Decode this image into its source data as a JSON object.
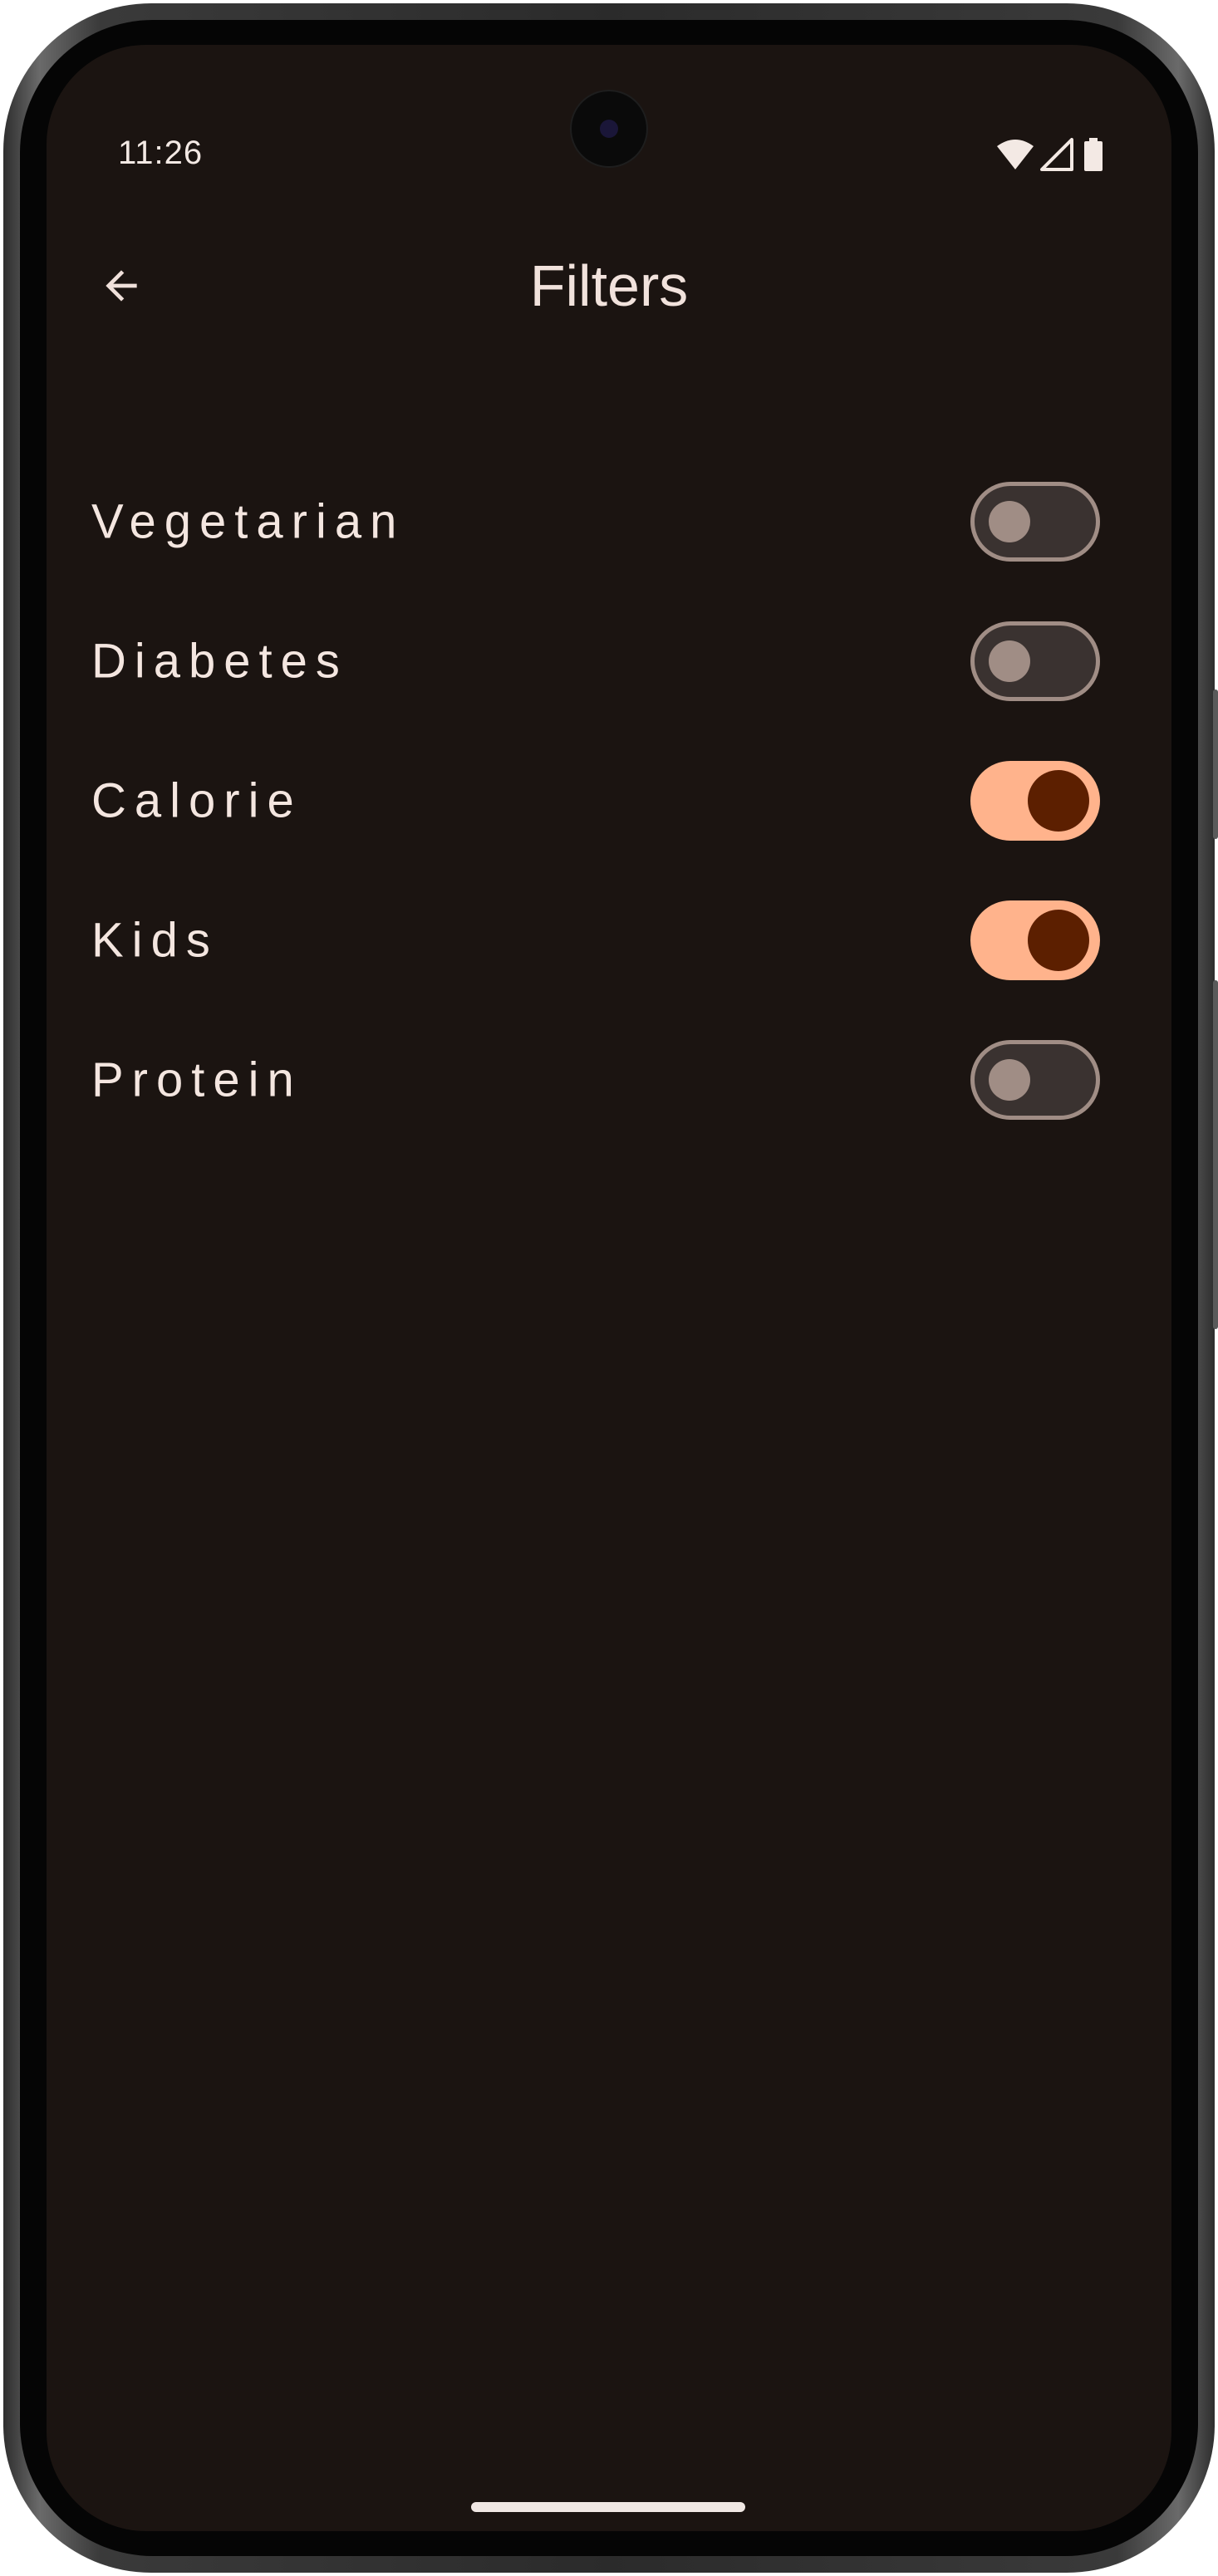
{
  "status_bar": {
    "time": "11:26"
  },
  "header": {
    "title": "Filters",
    "back_icon": "arrow-back-icon"
  },
  "filters": [
    {
      "label": "Vegetarian",
      "enabled": false
    },
    {
      "label": "Diabetes",
      "enabled": false
    },
    {
      "label": "Calorie",
      "enabled": true
    },
    {
      "label": "Kids",
      "enabled": true
    },
    {
      "label": "Protein",
      "enabled": false
    }
  ],
  "colors": {
    "background": "#1b1411",
    "switch_on_track": "#ffb38c",
    "switch_on_thumb": "#5c1f00",
    "switch_off_track": "#3a3230",
    "switch_off_outline": "#a08d85"
  }
}
